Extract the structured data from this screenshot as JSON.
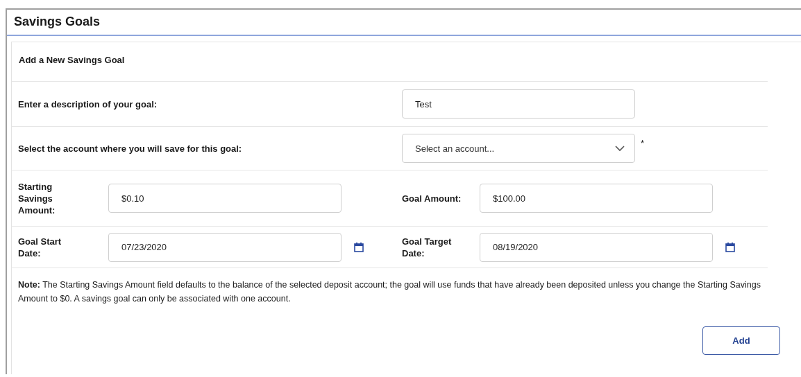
{
  "page": {
    "title": "Savings Goals"
  },
  "form": {
    "title": "Add a New Savings Goal",
    "description": {
      "label": "Enter a description of your goal:",
      "value": "Test"
    },
    "account": {
      "label": "Select the account where you will save for this goal:",
      "placeholder": "Select an account...",
      "required_mark": "*"
    },
    "pairs": [
      {
        "kind": "amount",
        "left": {
          "label": "Starting Savings Amount:",
          "value": "$0.10"
        },
        "right": {
          "label": "Goal Amount:",
          "value": "$100.00"
        }
      },
      {
        "kind": "date",
        "left": {
          "label": "Goal Start Date:",
          "value": "07/23/2020"
        },
        "right": {
          "label": "Goal Target Date:",
          "value": "08/19/2020"
        }
      }
    ],
    "note": {
      "lead": "Note:",
      "text": "The Starting Savings Amount field defaults to the balance of the selected deposit account; the goal will use funds that have already been deposited unless you change the Starting Savings Amount to $0. A savings goal can only be associated with one account."
    },
    "add_button": "Add"
  }
}
